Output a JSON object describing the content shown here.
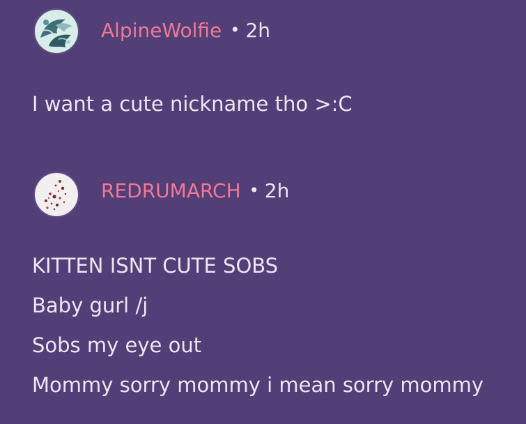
{
  "comments": [
    {
      "username": "AlpineWolfie",
      "separator": "•",
      "time": "2h",
      "avatar_icon": "wolf-avatar-icon",
      "lines": [
        "I want a cute nickname tho >:C"
      ]
    },
    {
      "username": "REDRUMARCH",
      "separator": "•",
      "time": "2h",
      "avatar_icon": "splatter-avatar-icon",
      "lines": [
        "KITTEN ISNT CUTE SOBS",
        "Baby gurl /j",
        "Sobs my eye out",
        "Mommy sorry mommy i mean sorry mommy"
      ]
    }
  ],
  "colors": {
    "background": "#533f77",
    "username": "#f07896",
    "text": "#ebe6f3"
  }
}
